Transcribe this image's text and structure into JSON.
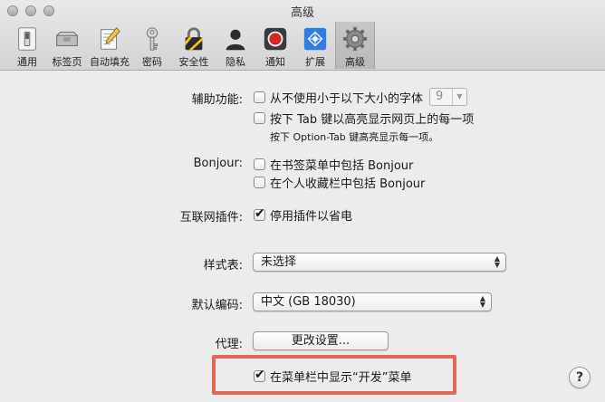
{
  "window": {
    "title": "高级"
  },
  "toolbar": [
    {
      "label": "通用",
      "icon": "switch-icon"
    },
    {
      "label": "标签页",
      "icon": "tabs-icon"
    },
    {
      "label": "自动填充",
      "icon": "pencil-form-icon"
    },
    {
      "label": "密码",
      "icon": "key-icon"
    },
    {
      "label": "安全性",
      "icon": "lock-icon"
    },
    {
      "label": "隐私",
      "icon": "silhouette-icon"
    },
    {
      "label": "通知",
      "icon": "notification-icon"
    },
    {
      "label": "扩展",
      "icon": "puzzle-icon"
    },
    {
      "label": "高级",
      "icon": "gear-icon",
      "active": true
    }
  ],
  "accessibility": {
    "label": "辅助功能:",
    "min_font_text": "从不使用小于以下大小的字体",
    "min_font_value": "9",
    "tab_text": "按下 Tab 键以高亮显示网页上的每一项",
    "tab_hint": "按下 Option-Tab 键高亮显示每一项。"
  },
  "bonjour": {
    "label": "Bonjour:",
    "bookmarks_menu": "在书签菜单中包括 Bonjour",
    "favorites_bar": "在个人收藏栏中包括 Bonjour"
  },
  "plugins": {
    "label": "互联网插件:",
    "stop_plugins": "停用插件以省电"
  },
  "stylesheet": {
    "label": "样式表:",
    "value": "未选择"
  },
  "encoding": {
    "label": "默认编码:",
    "value": "中文 (GB 18030)"
  },
  "proxy": {
    "label": "代理:",
    "button": "更改设置..."
  },
  "develop": {
    "text": "在菜单栏中显示“开发”菜单"
  },
  "help": {
    "glyph": "?"
  },
  "colors": {
    "highlight": "#e2685a",
    "record_red": "#d9241f"
  }
}
